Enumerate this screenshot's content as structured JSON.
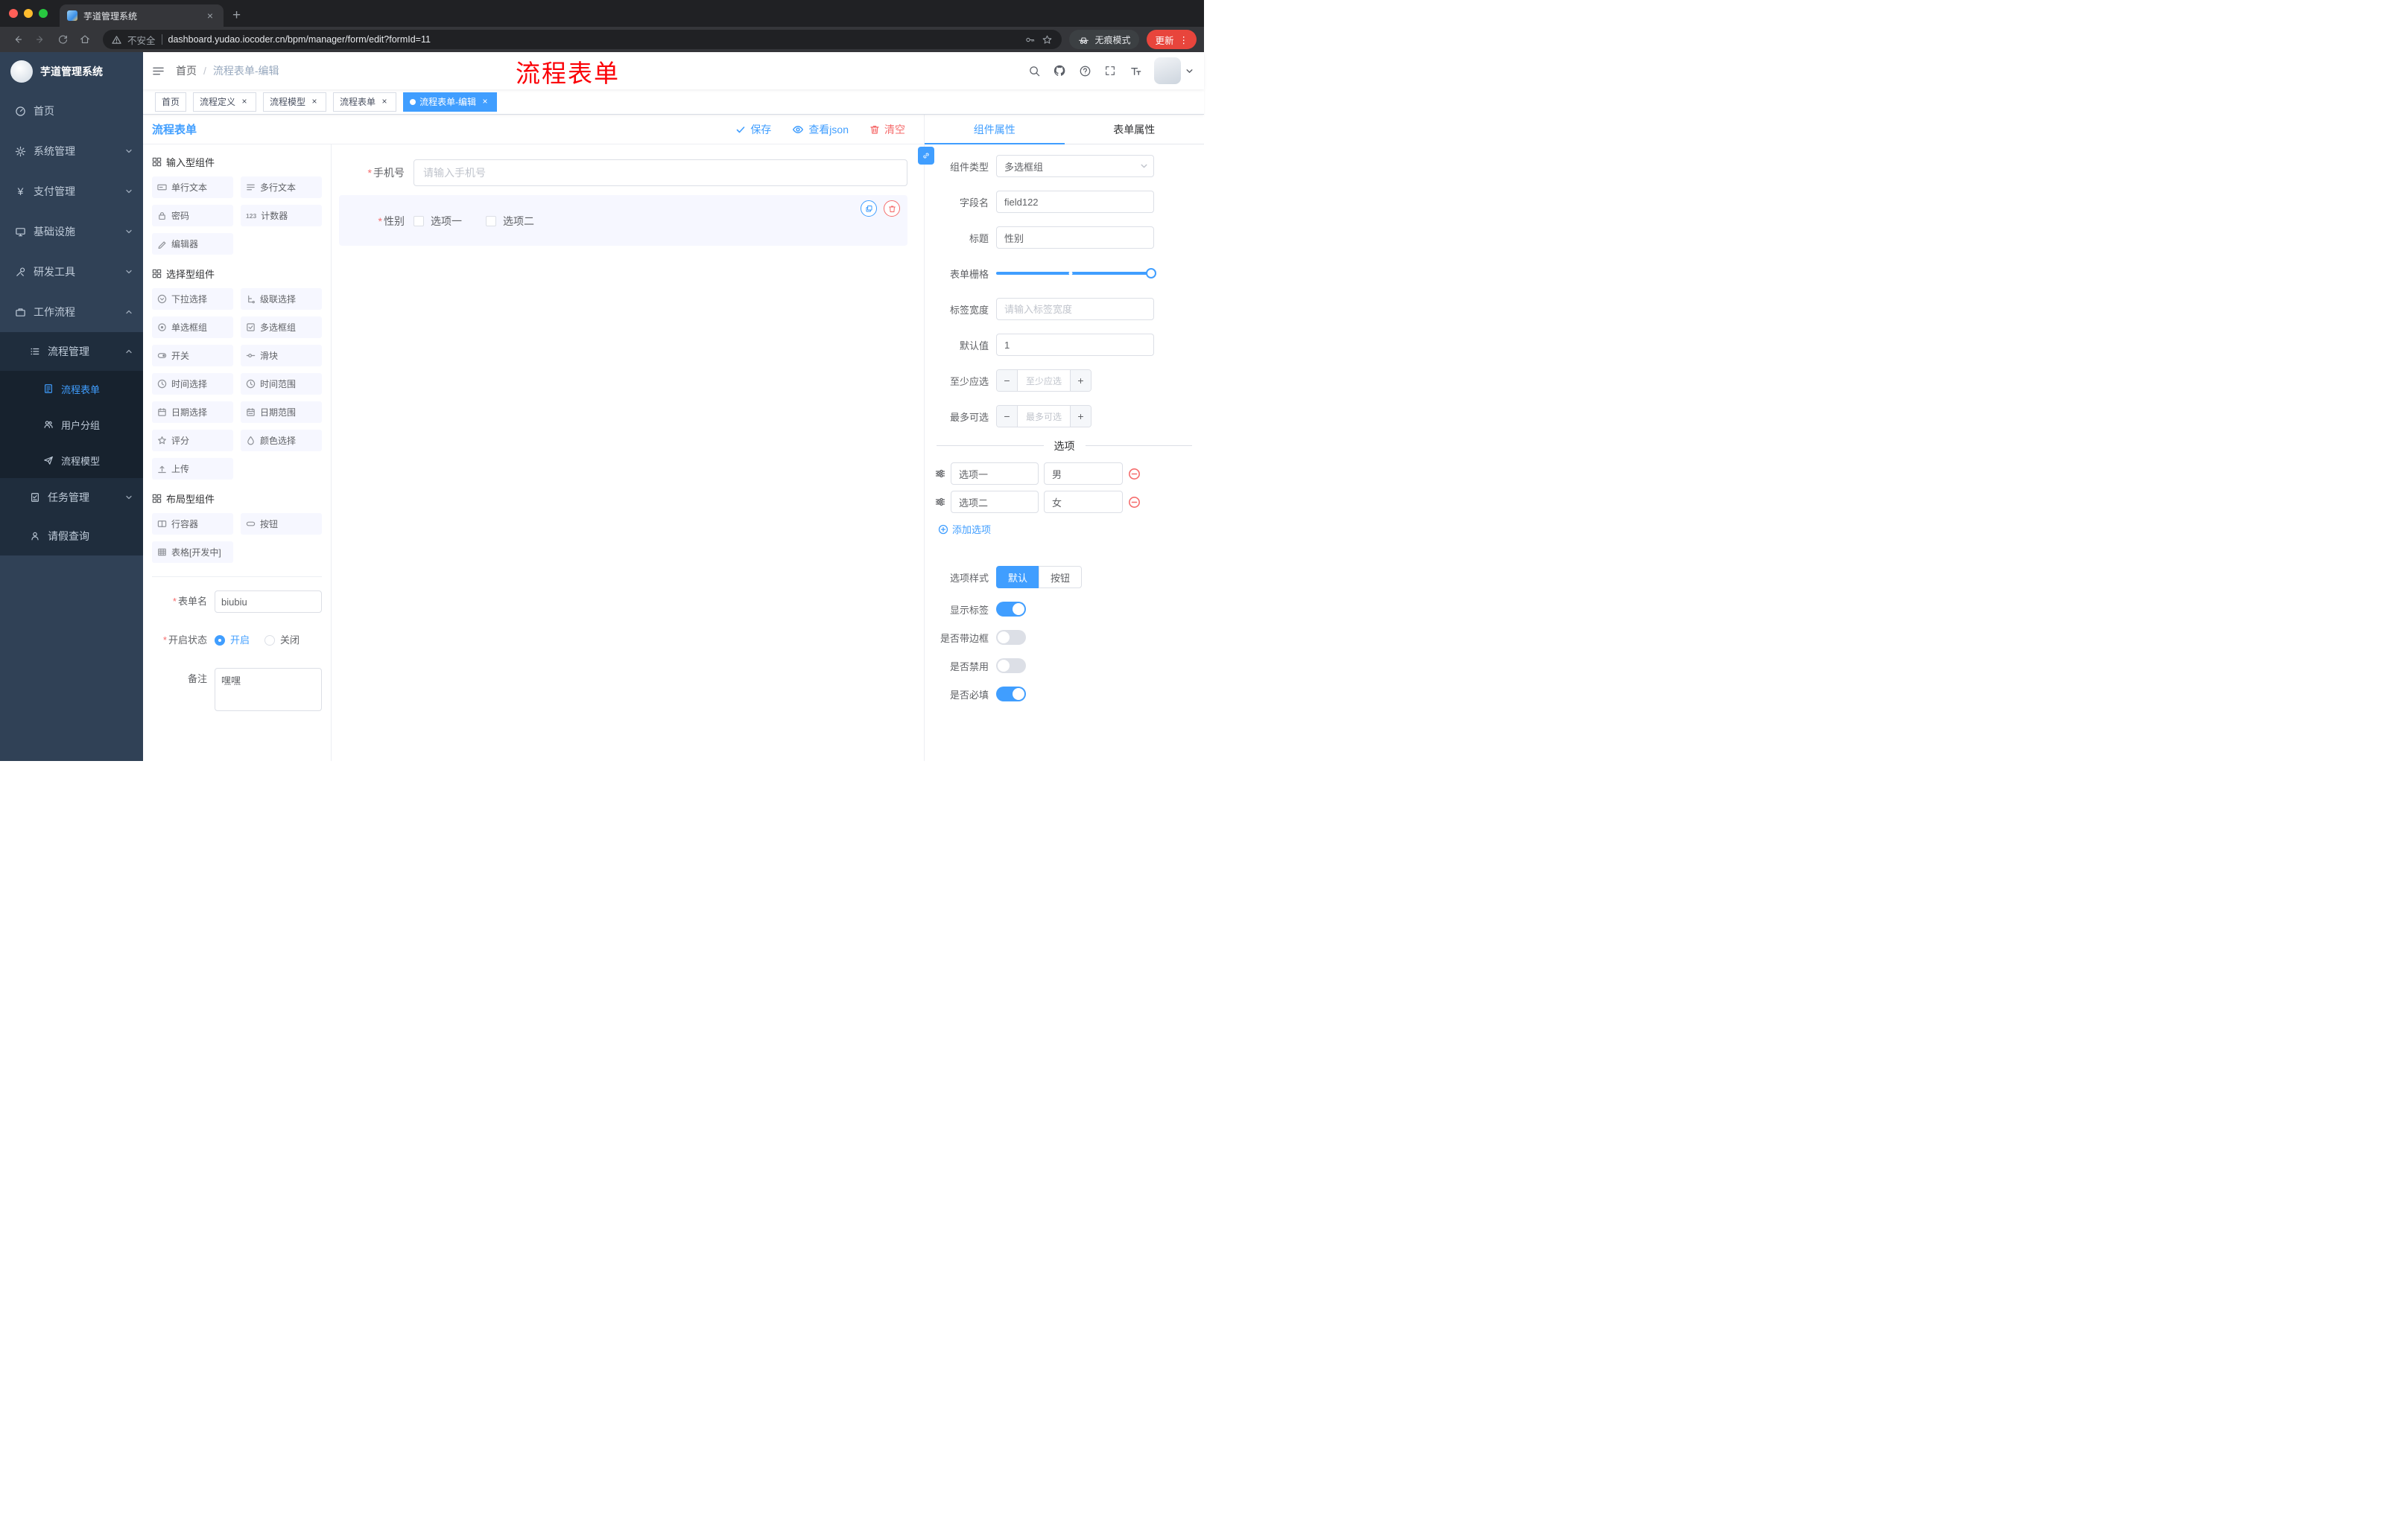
{
  "icons": {
    "required": "*",
    "close": "×",
    "new_tab": "+",
    "more_vertical": "⋮",
    "minus": "−",
    "plus": "+",
    "yen": "¥",
    "counter": "123"
  },
  "browser": {
    "tab": {
      "title": "芋道管理系统"
    },
    "toolbar": {
      "security": "不安全",
      "url": "dashboard.yudao.iocoder.cn/bpm/manager/form/edit?formId=11",
      "incognito": "无痕模式",
      "update": "更新"
    }
  },
  "sidebar": {
    "logo_title": "芋道管理系统",
    "items": [
      {
        "label": "首页"
      },
      {
        "label": "系统管理"
      },
      {
        "label": "支付管理"
      },
      {
        "label": "基础设施"
      },
      {
        "label": "研发工具"
      },
      {
        "label": "工作流程"
      },
      {
        "label": "流程管理"
      },
      {
        "label": "流程表单"
      },
      {
        "label": "用户分组"
      },
      {
        "label": "流程模型"
      },
      {
        "label": "任务管理"
      },
      {
        "label": "请假查询"
      }
    ]
  },
  "header": {
    "breadcrumb": {
      "home": "首页",
      "separator": "/",
      "current": "流程表单-编辑"
    },
    "annotation": "流程表单"
  },
  "tags": [
    {
      "label": "首页"
    },
    {
      "label": "流程定义"
    },
    {
      "label": "流程模型"
    },
    {
      "label": "流程表单"
    },
    {
      "label": "流程表单-编辑"
    }
  ],
  "designer": {
    "title": "流程表单",
    "actions": {
      "save": "保存",
      "view_json": "查看json",
      "clear": "清空"
    },
    "palette": {
      "groups": [
        {
          "title": "输入型组件",
          "items": [
            "单行文本",
            "多行文本",
            "密码",
            "计数器",
            "编辑器"
          ]
        },
        {
          "title": "选择型组件",
          "items": [
            "下拉选择",
            "级联选择",
            "单选框组",
            "多选框组",
            "开关",
            "滑块",
            "时间选择",
            "时间范围",
            "日期选择",
            "日期范围",
            "评分",
            "颜色选择",
            "上传"
          ]
        },
        {
          "title": "布局型组件",
          "items": [
            "行容器",
            "按钮",
            "表格[开发中]"
          ]
        }
      ]
    },
    "meta": {
      "form_name_label": "表单名",
      "form_name_value": "biubiu",
      "status_label": "开启状态",
      "status_on": "开启",
      "status_off": "关闭",
      "remark_label": "备注",
      "remark_value": "嘿嘿"
    },
    "canvas": {
      "phone": {
        "label": "手机号",
        "placeholder": "请输入手机号"
      },
      "gender": {
        "label": "性别",
        "options": [
          "选项一",
          "选项二"
        ]
      }
    },
    "props": {
      "tabs": [
        "组件属性",
        "表单属性"
      ],
      "component_type": {
        "label": "组件类型",
        "value": "多选框组"
      },
      "field_name": {
        "label": "字段名",
        "value": "field122"
      },
      "title": {
        "label": "标题",
        "value": "性别"
      },
      "grid": {
        "label": "表单栅格"
      },
      "label_width": {
        "label": "标签宽度",
        "placeholder": "请输入标签宽度"
      },
      "default_value": {
        "label": "默认值",
        "value": "1"
      },
      "min_select": {
        "label": "至少应选",
        "placeholder": "至少应选"
      },
      "max_select": {
        "label": "最多可选",
        "placeholder": "最多可选"
      },
      "options": {
        "divider": "选项",
        "rows": [
          {
            "label": "选项一",
            "value": "男"
          },
          {
            "label": "选项二",
            "value": "女"
          }
        ],
        "add": "添加选项"
      },
      "option_style": {
        "label": "选项样式",
        "default": "默认",
        "button": "按钮"
      },
      "switches": [
        {
          "label": "显示标签",
          "on": true
        },
        {
          "label": "是否带边框",
          "on": false
        },
        {
          "label": "是否禁用",
          "on": false
        },
        {
          "label": "是否必填",
          "on": true
        }
      ]
    }
  },
  "colors": {
    "accent": "#409eff",
    "danger": "#f56c6c",
    "sidebar": "#304156",
    "active_tag": "#409eff",
    "annotation": "#fb0006"
  }
}
